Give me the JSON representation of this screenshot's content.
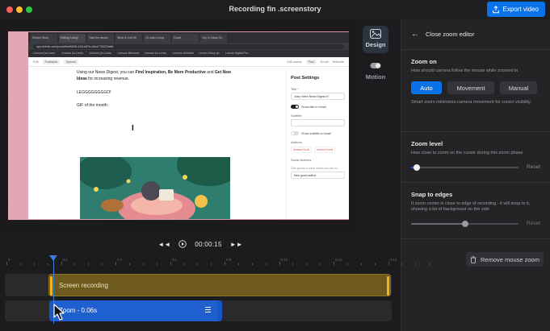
{
  "window": {
    "title": "Recording fin .screenstory",
    "export_label": "Export video"
  },
  "preview": {
    "browser_tabs": [
      "Screen Story",
      "Editing 'Lately'",
      "Take the amazi",
      "What is Curl Mi",
      "10 crisis in equ",
      "Guide",
      "Top 10 Ideas So"
    ],
    "url": "app.beehiiv.com/posts/ebe8f406-434f-b87b-a3ea7700220a6b",
    "bookmarks": [
      "Lemons (w-Lems..",
      "Lemons (w-Lems..",
      "Lemons (w-Lems..",
      "Lemons Behance",
      "Lemons (w-Lems..",
      "Lemons Dribbble",
      "Lemon Setup (w..",
      "Lemon Digital Pro.."
    ],
    "editor": {
      "exit": "Exit",
      "published": "Published",
      "synced": "Synced",
      "wordcount": "106 words",
      "tab_post": "Post",
      "tab_email": "Email",
      "tab_website": "Website"
    },
    "doc": {
      "p1_pre": "Using our News Digest, you can ",
      "p1_b1": "Find Inspiration, Be More Productive",
      "p1_mid": " and ",
      "p1_b2": "Get New Ideas",
      "p1_post": " for increasing revenue.",
      "line2": "LEGGGGGGGGO!",
      "line3": "GIF of the month:"
    },
    "settings": {
      "title": "Post Settings",
      "title_label": "Title *",
      "title_value": "Juicy Video News Digest #7",
      "show_title": "Show title in email",
      "subtitle_label": "Subtitle",
      "show_subtitle": "Show subtitle in email",
      "authors_label": "Authors",
      "author_1": "Andrew Kozik",
      "author_2": "Andrew Kozik",
      "guest_authors": "Guest Authors",
      "guest_hint": "Give guests to credit writers who are no",
      "new_guest": "New guest author"
    }
  },
  "rail": {
    "design_label": "Design",
    "motion_label": "Motion"
  },
  "panel": {
    "header": "Close zoom editor",
    "zoom_on": {
      "title": "Zoom on",
      "desc": "How should camera follow the mouse while zoomed in",
      "options": [
        "Auto",
        "Movement",
        "Manual"
      ],
      "selected": "Auto",
      "note": "Smart zoom minimizes camera movement for cursor visibility."
    },
    "zoom_level": {
      "title": "Zoom level",
      "desc": "How close to zoom on the cursor during this zoom phase",
      "value": 0.05,
      "reset": "Reset"
    },
    "snap": {
      "title": "Snap to edges",
      "desc": "If zoom center is close to edge of recording - it will snap to it, showing a bit of background on the side",
      "value": 0.5,
      "reset": "Reset"
    },
    "remove_label": "Remove mouse zoom"
  },
  "playback": {
    "time": "00:00:15"
  },
  "timeline": {
    "ticks": [
      "0",
      "0:2",
      "0:4",
      "0:6",
      "0:8",
      "0:10",
      "0:12",
      "0:14"
    ],
    "screen_clip_label": "Screen recording",
    "zoom_clip_label": "Zoom - 0.06s"
  },
  "colors": {
    "accent": "#0a72e8",
    "screen_clip": "#6f5a1d",
    "zoom_clip": "#1f5fcf"
  }
}
